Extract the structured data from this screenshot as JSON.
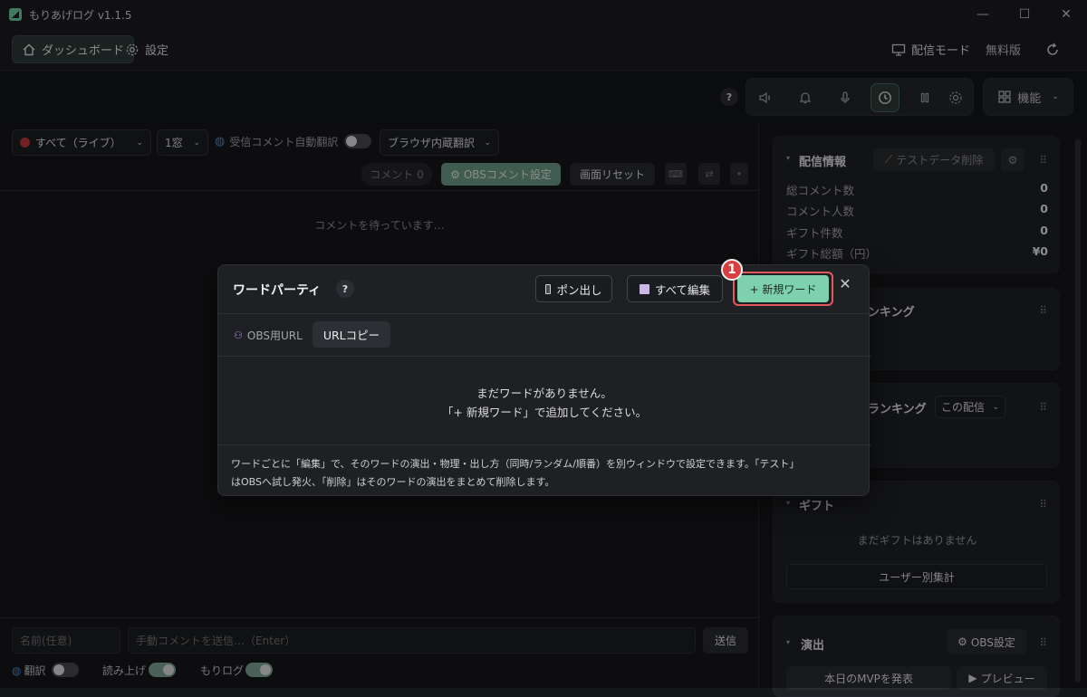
{
  "window": {
    "title": "もりあげログ v1.1.5",
    "controls": [
      "—",
      "☐",
      "✕"
    ]
  },
  "nav": {
    "dashboard": "ダッシュボード",
    "settings": "設定",
    "broadcast_mode": "配信モード",
    "plan": "無料版"
  },
  "toolbar": {
    "help": "?",
    "features": "機能"
  },
  "left": {
    "source_select": "すべて（ライブ）",
    "window_select": "1窓",
    "auto_translate_label": "受信コメント自動翻訳",
    "browser_translate": "ブラウザ内蔵翻訳",
    "comment_count": "コメント 0",
    "obs_comment_settings": "OBSコメント設定",
    "screen_reset": "画面リセット",
    "waiting": "コメントを待っています…",
    "name_placeholder": "名前(任意)",
    "comment_placeholder": "手動コメントを送信…（Enter）",
    "send": "送信",
    "translate_toggle": "翻訳",
    "read_aloud_toggle": "読み上げ",
    "morilog_toggle": "もりログ"
  },
  "right": {
    "stream_info": {
      "title": "配信情報",
      "delete_test_data": "テストデータ削除",
      "stats": [
        {
          "label": "総コメント数",
          "value": "0"
        },
        {
          "label": "コメント人数",
          "value": "0"
        },
        {
          "label": "ギフト件数",
          "value": "0"
        },
        {
          "label": "ギフト総額（円）",
          "value": "¥0"
        }
      ]
    },
    "ranking1": {
      "title": "ンキング"
    },
    "ranking2": {
      "title": "ランキング",
      "scope": "この配信"
    },
    "gift": {
      "title": "ギフト",
      "empty": "まだギフトはありません",
      "per_user": "ユーザー別集計"
    },
    "effects": {
      "title": "演出",
      "obs_settings": "OBS設定",
      "mvp": "本日のMVPを発表",
      "preview": "プレビュー"
    }
  },
  "modal": {
    "title": "ワードパーティ",
    "help": "?",
    "pop_button": "ポン出し",
    "edit_all": "すべて編集",
    "new_word": "+ 新規ワード",
    "obs_url_label": "OBS用URL",
    "url_copy": "URLコピー",
    "empty_line1": "まだワードがありません。",
    "empty_line2": "「+ 新規ワード」で追加してください。",
    "footer_line1": "ワードごとに「編集」で、そのワードの演出・物理・出し方（同時/ランダム/順番）を別ウィンドウで設定できます。「テスト」",
    "footer_line2": "はOBSへ試し発火、「削除」はそのワードの演出をまとめて削除します。"
  },
  "annotation": {
    "step": "1"
  },
  "colors": {
    "accent": "#7ed1ad",
    "highlight": "#e05a5a",
    "background": "#16171b"
  }
}
